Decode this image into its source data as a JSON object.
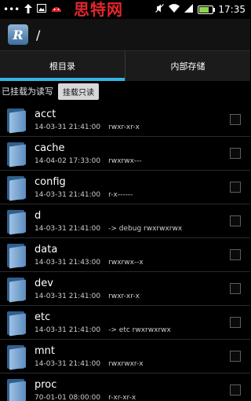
{
  "status": {
    "left_icons": [
      "more-dots-icon",
      "upload-arrow-icon",
      "image-icon",
      "android-robot-icon"
    ],
    "watermark": "思特网",
    "right_icons": [
      "mute-icon",
      "wifi-icon",
      "signal-icon",
      "battery-icon"
    ],
    "time": "17:35"
  },
  "header": {
    "app_icon_letter": "R",
    "path": "/"
  },
  "tabs": [
    {
      "label": "根目录",
      "active": true
    },
    {
      "label": "内部存储",
      "active": false
    }
  ],
  "mount": {
    "status": "已挂载为读写",
    "button": "挂载只读"
  },
  "files": [
    {
      "name": "acct",
      "date": "14-03-31 21:41:00",
      "info": "rwxr-xr-x"
    },
    {
      "name": "cache",
      "date": "14-04-02 17:33:00",
      "info": "rwxrwx---"
    },
    {
      "name": "config",
      "date": "14-03-31 21:41:00",
      "info": "r-x------"
    },
    {
      "name": "d",
      "date": "14-03-31 21:41:00",
      "info": "-> debug  rwxrwxrwx"
    },
    {
      "name": "data",
      "date": "14-03-31 21:43:00",
      "info": "rwxrwx--x"
    },
    {
      "name": "dev",
      "date": "14-03-31 21:41:00",
      "info": "rwxr-xr-x"
    },
    {
      "name": "etc",
      "date": "14-03-31 21:41:00",
      "info": "-> etc  rwxrwxrwx"
    },
    {
      "name": "mnt",
      "date": "14-03-31 21:41:00",
      "info": "rwxrwxr-x"
    },
    {
      "name": "proc",
      "date": "70-01-01 08:00:00",
      "info": "r-xr-xr-x"
    }
  ],
  "colors": {
    "accent": "#33b5e5",
    "watermark": "#e2262b",
    "folder": "#5c8dc0"
  }
}
